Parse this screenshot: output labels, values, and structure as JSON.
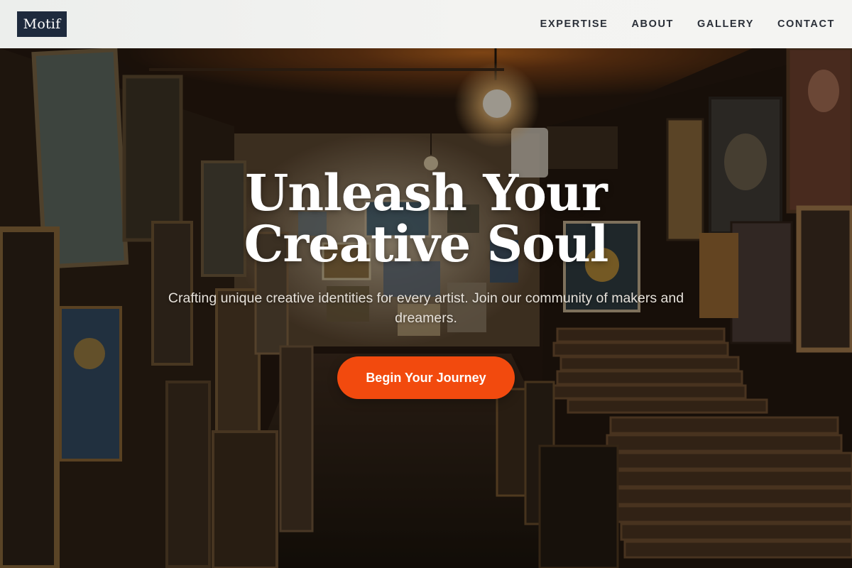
{
  "header": {
    "logo_text": "Motif",
    "nav": [
      {
        "label": "EXPERTISE"
      },
      {
        "label": "ABOUT"
      },
      {
        "label": "GALLERY"
      },
      {
        "label": "CONTACT"
      }
    ]
  },
  "hero": {
    "title": "Unleash Your Creative Soul",
    "subtitle": "Crafting unique creative identities for every artist. Join our community of makers and dreamers.",
    "cta_label": "Begin Your Journey",
    "cta_color": "#f24a0e",
    "background_icon": "art-gallery-photo"
  },
  "colors": {
    "logo_bg": "#1e2a3d",
    "header_bg": "#f2f2f0",
    "accent": "#f24a0e"
  }
}
